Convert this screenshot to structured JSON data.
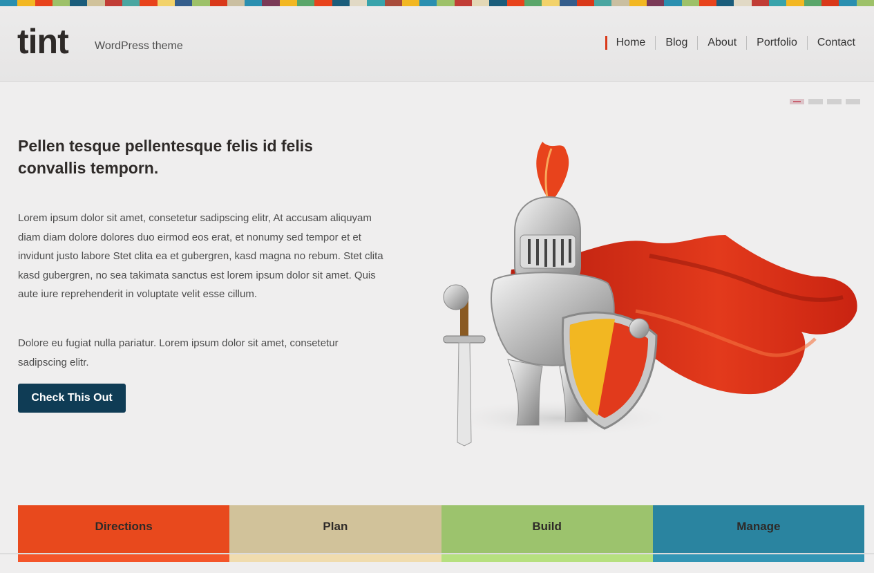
{
  "stripe_colors": [
    "#2a8fb0",
    "#f2b722",
    "#e8431c",
    "#9dc169",
    "#1b5d7b",
    "#d0c29b",
    "#c13d36",
    "#4aa6a1",
    "#e8431c",
    "#f2d26a",
    "#355e8c",
    "#9dc169",
    "#d9391a",
    "#cabfa1",
    "#2a8fb0",
    "#7b3a57",
    "#f2b722",
    "#5aa66a",
    "#e8431c",
    "#1b5d7b",
    "#e1d9c5",
    "#38a3ab",
    "#a84c3b",
    "#f2b722",
    "#2a8fb0",
    "#9dc169",
    "#c13d36",
    "#e3d8b6",
    "#1b5d7b",
    "#e8431c",
    "#5aa66a",
    "#f2d26a",
    "#355e8c",
    "#d9391a",
    "#4aa6a1",
    "#cabfa1",
    "#f2b722",
    "#7b3a57",
    "#2a8fb0",
    "#9dc169",
    "#e8431c",
    "#1b5d7b",
    "#e1d9c5",
    "#c13d36",
    "#38a3ab",
    "#f2b722",
    "#5aa66a",
    "#d9391a",
    "#2a8fb0",
    "#9dc169"
  ],
  "header": {
    "logo": "tint",
    "tagline": "WordPress theme",
    "nav": [
      {
        "label": "Home",
        "active": true
      },
      {
        "label": "Blog"
      },
      {
        "label": "About"
      },
      {
        "label": "Portfolio"
      },
      {
        "label": "Contact"
      }
    ]
  },
  "slider": {
    "pages": 4,
    "active_page": 1
  },
  "hero": {
    "headline": "Pellen tesque pellentesque felis id felis convallis temporn.",
    "paragraph1": "Lorem ipsum dolor sit amet, consetetur sadipscing elitr, At accusam aliquyam diam diam dolore dolores duo eirmod eos erat, et nonumy sed tempor et et invidunt justo labore Stet clita ea et gubergren, kasd magna no rebum. Stet clita kasd gubergren, no sea takimata sanctus est lorem ipsum dolor sit amet. Quis aute iure reprehenderit in voluptate velit esse cillum.",
    "paragraph2": "Dolore eu fugiat nulla pariatur. Lorem ipsum dolor sit amet, consetetur sadipscing elitr.",
    "cta_label": "Check This Out",
    "image": "knight-illustration"
  },
  "tabs": [
    {
      "label": "Directions",
      "color": "#e8491d",
      "bar": "#f4552a"
    },
    {
      "label": "Plan",
      "color": "#d1c29a",
      "bar": "#f0dcae"
    },
    {
      "label": "Build",
      "color": "#9cc36d",
      "bar": "#b6e07f"
    },
    {
      "label": "Manage",
      "color": "#2a84a0",
      "bar": "#3396b5"
    }
  ],
  "colors": {
    "accent": "#d9391a",
    "button": "#0f3c55"
  }
}
